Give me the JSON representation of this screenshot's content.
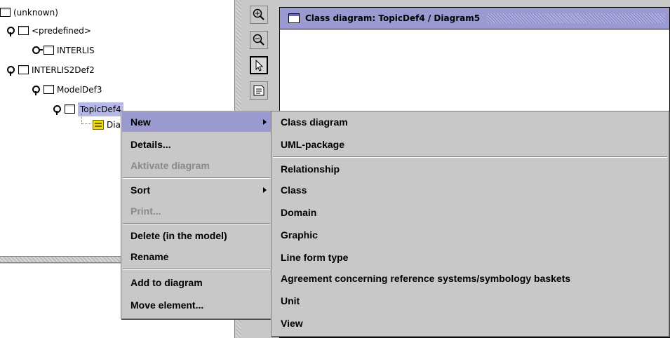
{
  "tree": {
    "nodes": [
      {
        "label": "(unknown)"
      },
      {
        "label": "<predefined>"
      },
      {
        "label": "INTERLIS"
      },
      {
        "label": "INTERLIS2Def2"
      },
      {
        "label": "ModelDef3"
      },
      {
        "label": "TopicDef4"
      },
      {
        "label": "Diagram5"
      }
    ]
  },
  "diagram_window": {
    "title": "Class diagram: TopicDef4 / Diagram5"
  },
  "toolbar": {
    "zoom_in_icon": "zoom-in",
    "zoom_out_icon": "zoom-out",
    "select_icon": "arrow-pointer",
    "note_icon": "note"
  },
  "context_menu": {
    "items": [
      {
        "label": "New",
        "submenu": true,
        "enabled": true
      },
      {
        "label": "Details...",
        "enabled": true
      },
      {
        "label": "Aktivate diagram",
        "enabled": false
      },
      {
        "label": "Sort",
        "submenu": true,
        "enabled": true
      },
      {
        "label": "Print...",
        "enabled": false
      },
      {
        "label": "Delete (in the model)",
        "enabled": true
      },
      {
        "label": "Rename",
        "enabled": true
      },
      {
        "label": "Add to diagram",
        "enabled": true
      },
      {
        "label": "Move element...",
        "enabled": true
      }
    ]
  },
  "submenu": {
    "items": [
      {
        "label": "Class diagram"
      },
      {
        "label": "UML-package"
      },
      {
        "label": "Relationship"
      },
      {
        "label": "Class"
      },
      {
        "label": "Domain"
      },
      {
        "label": "Graphic"
      },
      {
        "label": "Line form type"
      },
      {
        "label": "Agreement concerning reference systems/symbology baskets"
      },
      {
        "label": "Unit"
      },
      {
        "label": "View"
      }
    ]
  },
  "colors": {
    "highlight": "#9a9ad0",
    "panel": "#c8c8c8"
  }
}
